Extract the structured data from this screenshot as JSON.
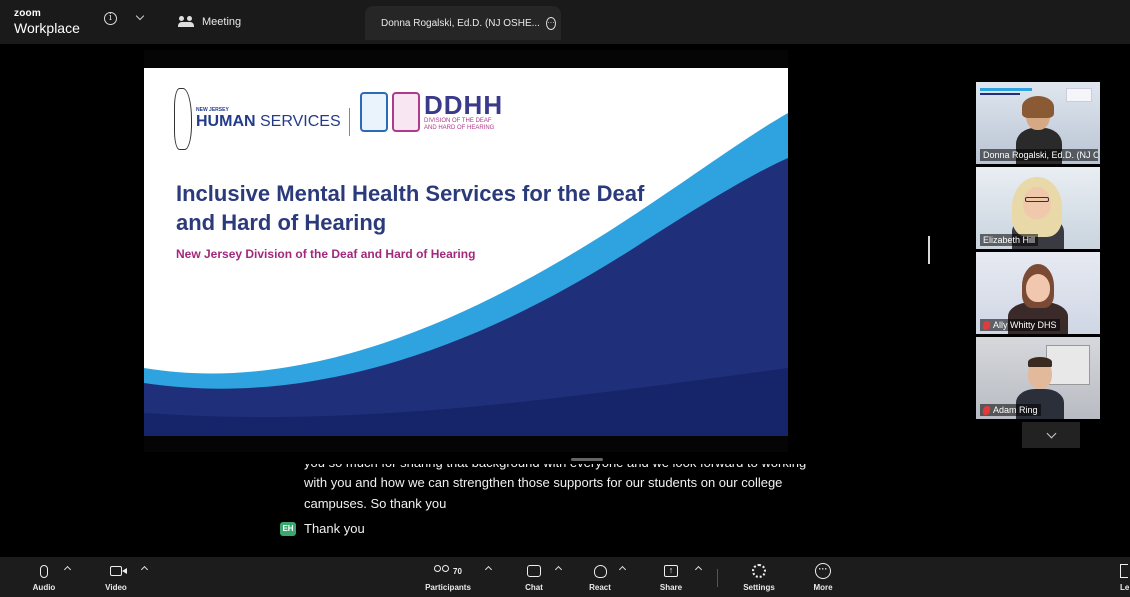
{
  "titlebar": {
    "brand_small": "zoom",
    "brand_big": "Workplace",
    "meeting_tab": "Meeting",
    "speaker_tab": "Donna Rogalski, Ed.D. (NJ OSHE..."
  },
  "slide": {
    "nj_small": "NEW JERSEY",
    "nj_big_bold": "HUMAN",
    "nj_big_rest": " SERVICES",
    "ddhh_title": "DDHH",
    "ddhh_sub1": "DIVISION OF THE DEAF",
    "ddhh_sub2": "AND HARD OF HEARING",
    "title": "Inclusive Mental Health Services for the Deaf and Hard of Hearing",
    "subtitle": "New Jersey Division of the Deaf and Hard of Hearing",
    "colors": {
      "title": "#2b3a7a",
      "subtitle": "#a3287b",
      "wave_dark": "#1f2f7a",
      "wave_light": "#2ea3e0"
    }
  },
  "participants": [
    {
      "name": "Donna Rogalski, Ed.D. (NJ OS...",
      "muted": false,
      "active": false
    },
    {
      "name": "Elizabeth Hill",
      "muted": false,
      "active": true
    },
    {
      "name": "Ally Whitty DHS",
      "muted": true,
      "active": false
    },
    {
      "name": "Adam Ring",
      "muted": true,
      "active": false
    }
  ],
  "captions": {
    "cut_line": "you so much for sharing that background with everyone and we look forward to working",
    "line2": "with you and how we can strengthen those supports for our students on our college",
    "line3": "campuses. So thank you",
    "reply_initials": "EH",
    "reply_text": "Thank you"
  },
  "toolbar": {
    "audio": "Audio",
    "video": "Video",
    "participants": "Participants",
    "participants_count": "70",
    "chat": "Chat",
    "react": "React",
    "share": "Share",
    "settings": "Settings",
    "more": "More",
    "leave_partial": "Le"
  }
}
